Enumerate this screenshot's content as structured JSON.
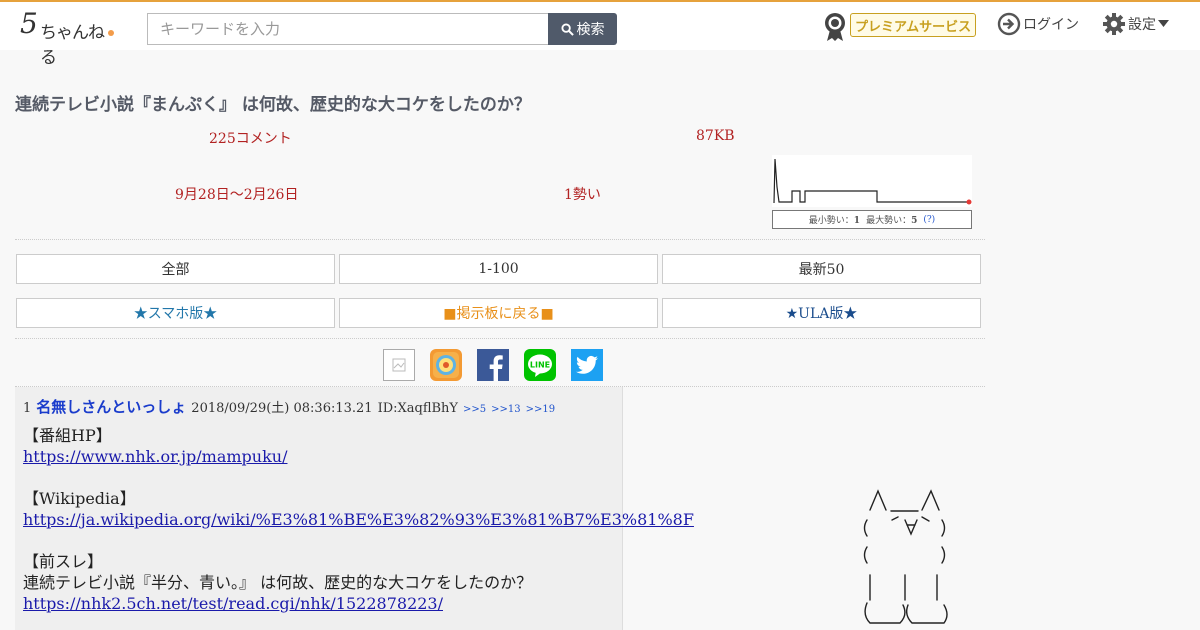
{
  "header": {
    "logo": {
      "five": "5",
      "text": "ちゃんねる"
    },
    "search": {
      "placeholder": "キーワードを入力",
      "button_label": "検索"
    },
    "premium_label": "プレミアムサービス",
    "login_label": "ログイン",
    "settings_label": "設定",
    "colors": {
      "accent": "#e6a23c",
      "search_button": "#505a6a",
      "premium": "#c8a020"
    }
  },
  "thread": {
    "title": "連続テレビ小説『まんぷく』 は何故、歴史的な大コケをしたのか？",
    "comments": "225コメント",
    "size": "87KB",
    "period": "9月28日〜2月26日",
    "momentum": "1勢い",
    "graph": {
      "min_label": "最小勢い：",
      "min_value": "1",
      "max_label": "最大勢い：",
      "max_value": "5",
      "help": "(?)"
    },
    "nav_buttons": [
      "全部",
      "1-100",
      "最新50"
    ],
    "nav_links": [
      "★スマホ版★",
      "■掲示板に戻る■",
      "★ULA版★"
    ],
    "share_icons": [
      "broken-image-icon",
      "bookmark-app-icon",
      "facebook-icon",
      "line-icon",
      "twitter-icon"
    ]
  },
  "post": {
    "number": "1",
    "name": "名無しさんといっしょ",
    "date": "2018/09/29(土) 08:36:13.21",
    "id": "ID:XaqflBhY",
    "replies": [
      ">>5",
      ">>13",
      ">>19"
    ],
    "lines": [
      {
        "text": "【番組HP】",
        "link": false
      },
      {
        "text": "https://www.nhk.or.jp/mampuku/",
        "link": true
      },
      {
        "text": "",
        "link": false
      },
      {
        "text": "【Wikipedia】",
        "link": false
      },
      {
        "text": "https://ja.wikipedia.org/wiki/%E3%81%BE%E3%82%93%E3%81%B7%E3%81%8F",
        "link": true
      },
      {
        "text": "",
        "link": false
      },
      {
        "text": "【前スレ】",
        "link": false
      },
      {
        "text": "連続テレビ小説『半分、青い。』 は何故、歴史的な大コケをしたのか？",
        "link": false
      },
      {
        "text": "https://nhk2.5ch.net/test/read.cgi/nhk/1522878223/",
        "link": true
      }
    ]
  }
}
